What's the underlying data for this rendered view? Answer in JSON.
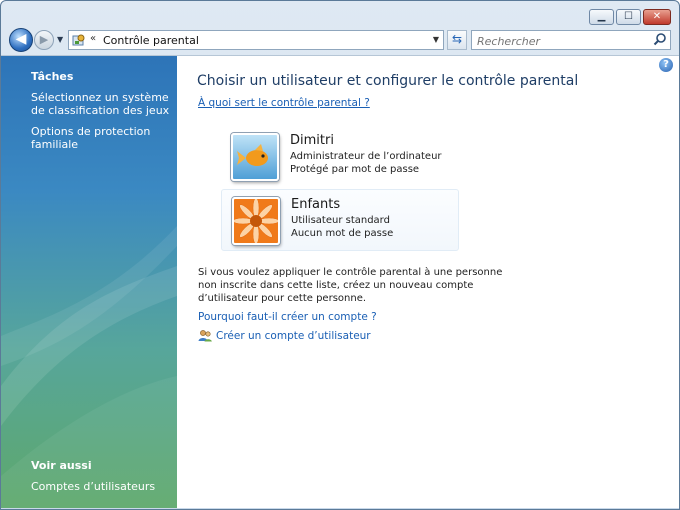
{
  "window": {
    "buttons": {
      "minimize": "▁",
      "maximize": "☐",
      "close": "✕"
    }
  },
  "navbar": {
    "back_icon": "back-arrow-icon",
    "forward_icon": "forward-arrow-icon",
    "chevron": "«",
    "address": "Contrôle parental",
    "refresh_icon": "refresh-icon",
    "search_placeholder": "Rechercher"
  },
  "sidebar": {
    "tasks_title": "Tâches",
    "tasks": [
      "Sélectionnez un système de classification des jeux",
      "Options de protection familiale"
    ],
    "see_also_title": "Voir aussi",
    "see_also": [
      "Comptes d’utilisateurs"
    ]
  },
  "main": {
    "heading": "Choisir un utilisateur et configurer le contrôle parental",
    "help_link": "À quoi sert le contrôle parental ?",
    "users": [
      {
        "name": "Dimitri",
        "line1": "Administrateur de l’ordinateur",
        "line2": "Protégé par mot de passe",
        "avatar": "goldfish-avatar"
      },
      {
        "name": "Enfants",
        "line1": "Utilisateur standard",
        "line2": "Aucun mot de passe",
        "avatar": "orange-flower-avatar"
      }
    ],
    "info": "Si vous voulez appliquer le contrôle parental à une personne non inscrite dans cette liste, créez un nouveau compte d’utilisateur pour cette personne.",
    "why_link": "Pourquoi faut-il créer un compte ?",
    "create_link": "Créer un compte d’utilisateur"
  },
  "colors": {
    "heading": "#1f3e66",
    "link": "#1a5fb4",
    "sidebar_top": "#2d74b8",
    "sidebar_bottom": "#5ea86b"
  }
}
